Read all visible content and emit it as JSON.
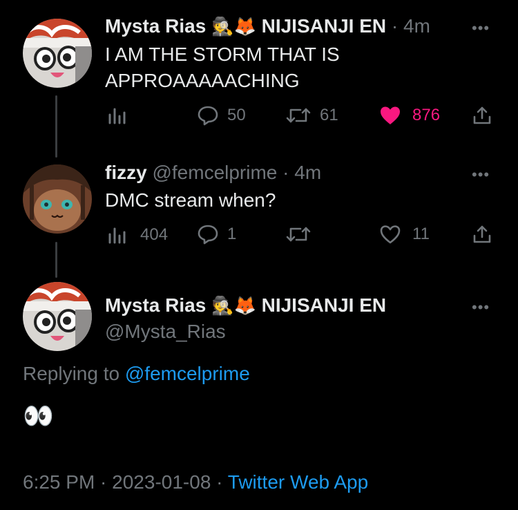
{
  "tweets": [
    {
      "display_name": "Mysta Rias",
      "badge_emojis": "🕵️🦊",
      "affiliation": "NIJISANJI EN",
      "time": "· 4m",
      "text_lines": [
        "I AM THE STORM THAT IS",
        "APPROAAAAACHING"
      ],
      "actions": {
        "views": "",
        "replies": "50",
        "retweets": "61",
        "likes": "876"
      },
      "liked": true
    },
    {
      "display_name": "fizzy",
      "handle": "@femcelprime",
      "time": "· 4m",
      "text": "DMC stream when?",
      "actions": {
        "views": "404",
        "replies": "1",
        "retweets": "",
        "likes": "11"
      },
      "liked": false
    }
  ],
  "focused": {
    "display_name": "Mysta Rias",
    "badge_emojis": "🕵️🦊",
    "affiliation": "NIJISANJI EN",
    "handle": "@Mysta_Rias",
    "replying_prefix": "Replying to",
    "replying_handle": "@femcelprime",
    "text": "👀",
    "timestamp": "6:25 PM · 2023-01-08 ·",
    "source": "Twitter Web App"
  },
  "icons": {
    "more": "more-icon",
    "views": "views-icon",
    "reply": "reply-icon",
    "retweet": "retweet-icon",
    "like": "heart-icon",
    "share": "share-icon"
  },
  "colors": {
    "background": "#000000",
    "text": "#e7e9ea",
    "muted": "#71767b",
    "link": "#1d9bf0",
    "like": "#f91880"
  },
  "more_glyph": "•••"
}
